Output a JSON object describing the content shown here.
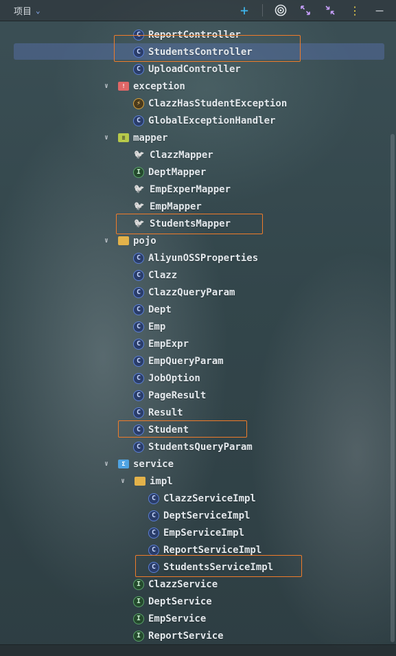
{
  "header": {
    "title": "项目",
    "icons": [
      "chevron-down-icon",
      "add-icon",
      "target-icon",
      "expand-icon",
      "collapse-icon",
      "more-icon",
      "minimize-icon"
    ]
  },
  "tree": [
    {
      "label": "ReportController",
      "type": "class",
      "icon": "class-icon"
    },
    {
      "label": "StudentsController",
      "type": "class",
      "icon": "class-icon",
      "selected": true,
      "highlighted": true
    },
    {
      "label": "UploadController",
      "type": "class",
      "icon": "class-icon"
    },
    {
      "label": "exception",
      "type": "folder",
      "icon": "exception-folder-icon",
      "expanded": true
    },
    {
      "label": "ClazzHasStudentException",
      "type": "exception",
      "icon": "exception-icon"
    },
    {
      "label": "GlobalExceptionHandler",
      "type": "class",
      "icon": "class-icon"
    },
    {
      "label": "mapper",
      "type": "folder",
      "icon": "mapper-folder-icon",
      "expanded": true
    },
    {
      "label": "ClazzMapper",
      "type": "mapper",
      "icon": "mybatis-mapper-icon"
    },
    {
      "label": "DeptMapper",
      "type": "interface",
      "icon": "interface-icon"
    },
    {
      "label": "EmpExperMapper",
      "type": "mapper",
      "icon": "mybatis-mapper-icon"
    },
    {
      "label": "EmpMapper",
      "type": "mapper",
      "icon": "mybatis-mapper-icon"
    },
    {
      "label": "StudentsMapper",
      "type": "mapper",
      "icon": "mybatis-mapper-icon",
      "highlighted": true
    },
    {
      "label": "pojo",
      "type": "folder",
      "icon": "folder-icon",
      "expanded": true
    },
    {
      "label": "AliyunOSSProperties",
      "type": "class",
      "icon": "class-icon"
    },
    {
      "label": "Clazz",
      "type": "class",
      "icon": "class-icon"
    },
    {
      "label": "ClazzQueryParam",
      "type": "class",
      "icon": "class-icon"
    },
    {
      "label": "Dept",
      "type": "class",
      "icon": "class-icon"
    },
    {
      "label": "Emp",
      "type": "class",
      "icon": "class-icon"
    },
    {
      "label": "EmpExpr",
      "type": "class",
      "icon": "class-icon"
    },
    {
      "label": "EmpQueryParam",
      "type": "class",
      "icon": "class-icon"
    },
    {
      "label": "JobOption",
      "type": "class",
      "icon": "class-icon"
    },
    {
      "label": "PageResult",
      "type": "class",
      "icon": "class-icon"
    },
    {
      "label": "Result",
      "type": "class",
      "icon": "class-icon"
    },
    {
      "label": "Student",
      "type": "class",
      "icon": "class-icon",
      "highlighted": true
    },
    {
      "label": "StudentsQueryParam",
      "type": "class",
      "icon": "class-icon"
    },
    {
      "label": "service",
      "type": "folder",
      "icon": "service-folder-icon",
      "expanded": true
    },
    {
      "label": "impl",
      "type": "folder",
      "icon": "folder-icon",
      "expanded": true
    },
    {
      "label": "ClazzServiceImpl",
      "type": "class",
      "icon": "class-icon"
    },
    {
      "label": "DeptServiceImpl",
      "type": "class",
      "icon": "class-icon"
    },
    {
      "label": "EmpServiceImpl",
      "type": "class",
      "icon": "class-icon"
    },
    {
      "label": "ReportServiceImpl",
      "type": "class",
      "icon": "class-icon"
    },
    {
      "label": "StudentsServiceImpl",
      "type": "class",
      "icon": "class-icon",
      "highlighted": true
    },
    {
      "label": "ClazzService",
      "type": "interface",
      "icon": "interface-icon"
    },
    {
      "label": "DeptService",
      "type": "interface",
      "icon": "interface-icon"
    },
    {
      "label": "EmpService",
      "type": "interface",
      "icon": "interface-icon"
    },
    {
      "label": "ReportService",
      "type": "interface",
      "icon": "interface-icon"
    }
  ],
  "colors": {
    "highlight_border": "#f07c2a",
    "selection": "#546ea0",
    "class_icon": "#5b7fd6",
    "interface_icon": "#5aa36a"
  }
}
